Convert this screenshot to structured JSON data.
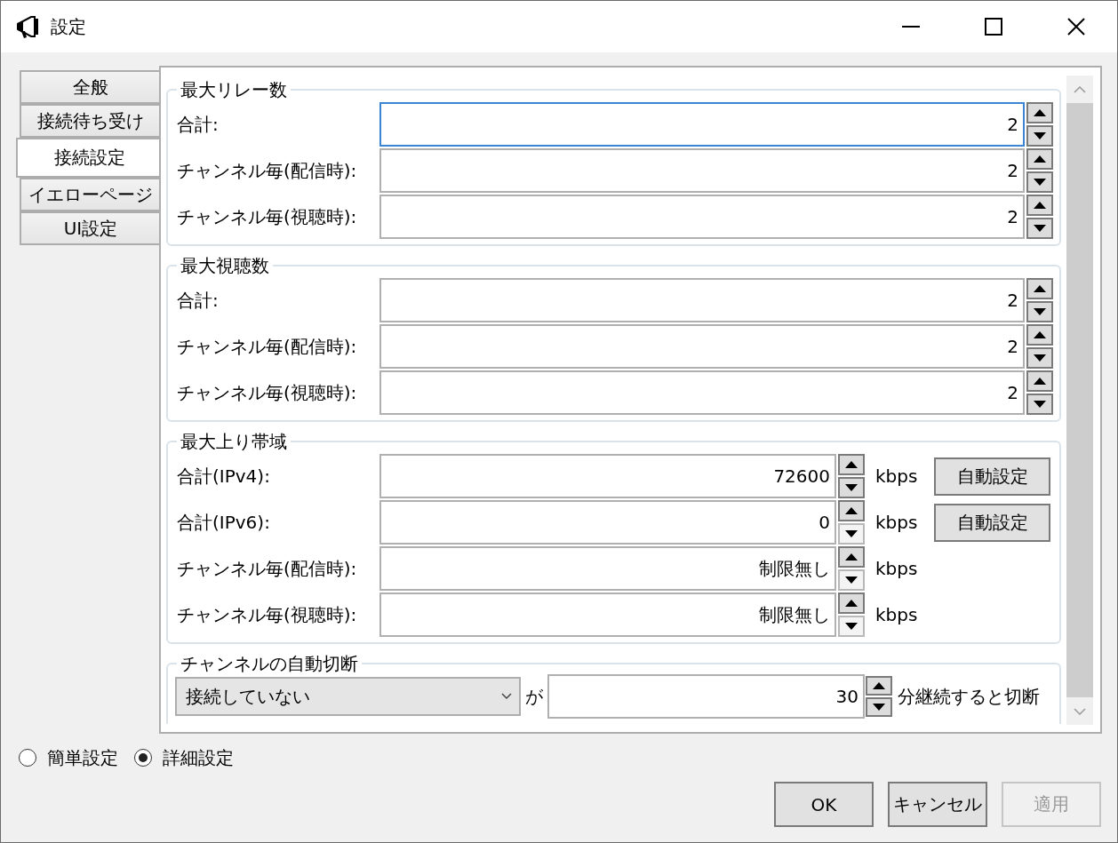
{
  "window": {
    "title": "設定"
  },
  "tabs": [
    {
      "label": "全般",
      "selected": false
    },
    {
      "label": "接続待ち受け",
      "selected": false
    },
    {
      "label": "接続設定",
      "selected": true
    },
    {
      "label": "イエローページ",
      "selected": false
    },
    {
      "label": "UI設定",
      "selected": false
    }
  ],
  "groups": [
    {
      "title": "最大リレー数",
      "rows": [
        {
          "label": "合計:",
          "value": "2",
          "focused": true,
          "down_disabled": false
        },
        {
          "label": "チャンネル毎(配信時):",
          "value": "2",
          "focused": false,
          "down_disabled": false
        },
        {
          "label": "チャンネル毎(視聴時):",
          "value": "2",
          "focused": false,
          "down_disabled": false
        }
      ]
    },
    {
      "title": "最大視聴数",
      "rows": [
        {
          "label": "合計:",
          "value": "2",
          "focused": false,
          "down_disabled": false
        },
        {
          "label": "チャンネル毎(配信時):",
          "value": "2",
          "focused": false,
          "down_disabled": false
        },
        {
          "label": "チャンネル毎(視聴時):",
          "value": "2",
          "focused": false,
          "down_disabled": false
        }
      ]
    },
    {
      "title": "最大上り帯域",
      "rows": [
        {
          "label": "合計(IPv4):",
          "value": "72600",
          "focused": false,
          "down_disabled": false,
          "unit": "kbps",
          "button": "自動設定"
        },
        {
          "label": "合計(IPv6):",
          "value": "0",
          "focused": false,
          "down_disabled": true,
          "unit": "kbps",
          "button": "自動設定"
        },
        {
          "label": "チャンネル毎(配信時):",
          "value": "制限無し",
          "focused": false,
          "down_disabled": true,
          "unit": "kbps"
        },
        {
          "label": "チャンネル毎(視聴時):",
          "value": "制限無し",
          "focused": false,
          "down_disabled": true,
          "unit": "kbps"
        }
      ]
    }
  ],
  "auto_disconnect": {
    "title": "チャンネルの自動切断",
    "condition": "接続していない",
    "connector": "が",
    "value": "30",
    "suffix": "分継続すると切断"
  },
  "mode_options": [
    {
      "label": "簡単設定",
      "selected": false
    },
    {
      "label": "詳細設定",
      "selected": true
    }
  ],
  "buttons": [
    {
      "label": "OK",
      "disabled": false
    },
    {
      "label": "キャンセル",
      "disabled": false
    },
    {
      "label": "適用",
      "disabled": true
    }
  ]
}
